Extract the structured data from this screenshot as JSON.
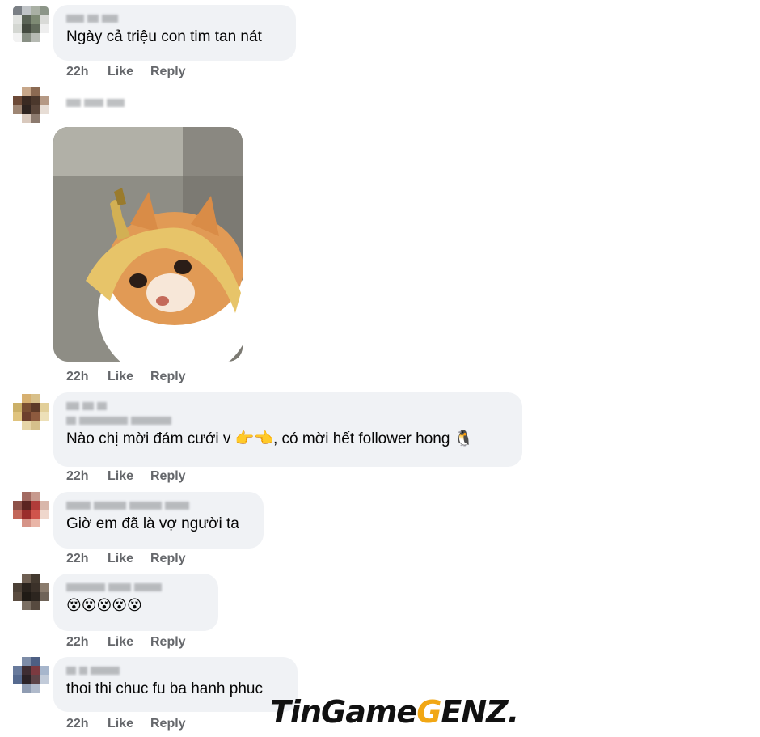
{
  "comments": [
    {
      "text": "Ngày cả triệu con tim tan nát",
      "time": "22h",
      "like": "Like",
      "reply": "Reply"
    },
    {
      "text": "",
      "time": "22h",
      "like": "Like",
      "reply": "Reply"
    },
    {
      "text": "Nào chị mời đám cưới v 👉👈, có mời hết follower hong 🐧",
      "time": "22h",
      "like": "Like",
      "reply": "Reply"
    },
    {
      "text": "Giờ em đã là vợ người ta",
      "time": "22h",
      "like": "Like",
      "reply": "Reply"
    },
    {
      "text": "😵😵😵😵😵",
      "time": "22h",
      "like": "Like",
      "reply": "Reply"
    },
    {
      "text": "thoi thi chuc fu ba hanh phuc",
      "time": "22h",
      "like": "Like",
      "reply": "Reply"
    }
  ],
  "watermark": {
    "part1": "TinGame",
    "part2": "G",
    "part3": "ENZ."
  },
  "colors": {
    "bubble": "#f0f2f5",
    "meta": "#65676b",
    "watermark_accent": "#f1a714"
  }
}
